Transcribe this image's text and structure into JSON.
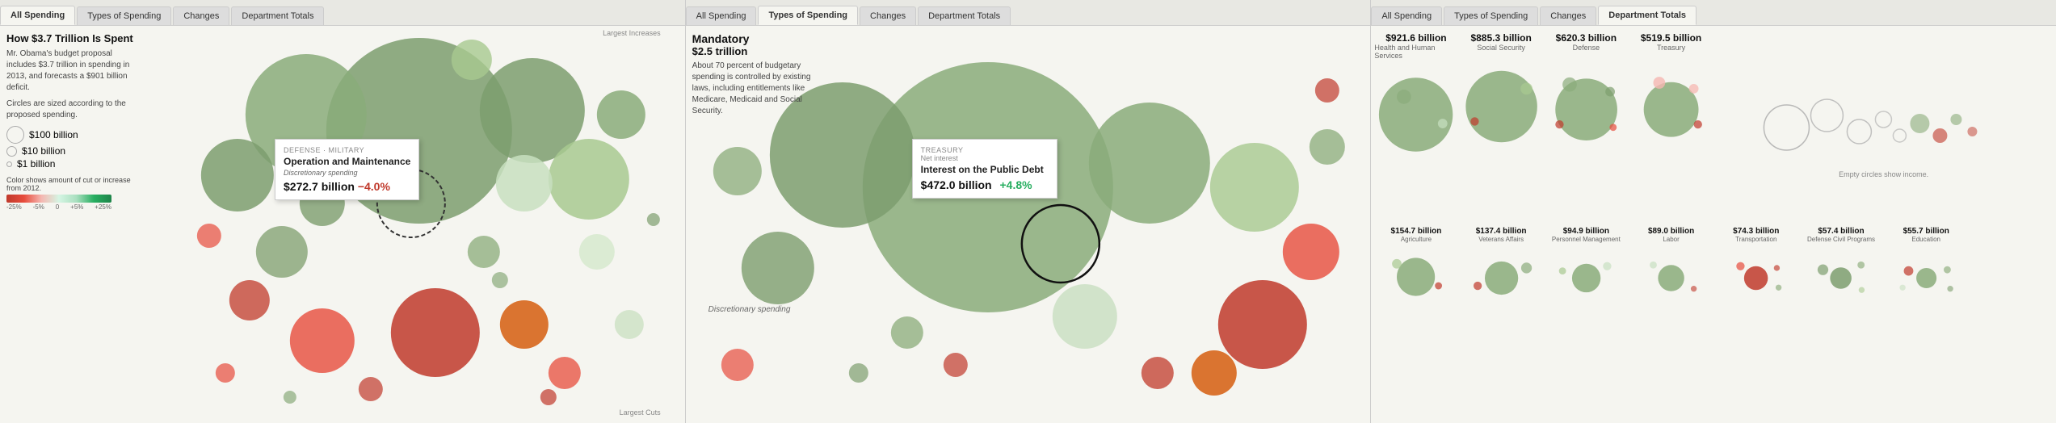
{
  "panels": [
    {
      "id": "panel1",
      "tabs": [
        "All Spending",
        "Types of Spending",
        "Changes",
        "Department Totals"
      ],
      "activeTab": "All Spending",
      "title": "How $3.7 Trillion Is Spent",
      "description": "Mr. Obama's budget proposal includes $3.7 trillion in spending in 2013, and forecasts a $901 billion deficit.",
      "circleNote": "Circles are sized according to the proposed spending.",
      "legendItems": [
        {
          "size": 28,
          "label": "$100 billion"
        },
        {
          "size": 16,
          "label": "$10 billion"
        },
        {
          "size": 8,
          "label": "$1 billion"
        }
      ],
      "colorLegendTitle": "Color shows amount of cut or increase from 2012.",
      "colorLabels": [
        "-25%",
        "-5%",
        "0",
        "+5%",
        "+25%"
      ],
      "tooltip": {
        "label": "DEFENSE · MILITARY",
        "title": "Operation and Maintenance",
        "subtitle": "Discretionary spending",
        "value": "$272.7 billion",
        "change": "−4.0%",
        "changeType": "negative"
      },
      "largestIncreasesLabel": "Largest Increases",
      "largestCutsLabel": "Largest Cuts"
    },
    {
      "id": "panel2",
      "tabs": [
        "All Spending",
        "Types of Spending",
        "Changes",
        "Department Totals"
      ],
      "activeTab": "Types of Spending",
      "mandatoryTitle": "Mandatory",
      "mandatoryAmount": "$2.5 trillion",
      "mandatoryDesc": "About 70 percent of budgetary spending is controlled by existing laws, including entitlements like Medicare, Medicaid and Social Security.",
      "tooltip": {
        "label": "TREASURY",
        "sublabel": "Net interest",
        "title": "Interest on the Public Debt",
        "value": "$472.0 billion",
        "change": "+4.8%",
        "changeType": "positive"
      },
      "discretionaryLabel": "Discretionary spending"
    },
    {
      "id": "panel3",
      "tabs": [
        "All Spending",
        "Types of Spending",
        "Changes",
        "Department Totals"
      ],
      "activeTab": "Department Totals",
      "emptyCirclesNote": "Empty circles show income.",
      "departments": [
        {
          "amount": "$921.6 billion",
          "name": "Health and Human Services",
          "size": 110,
          "color": "#7d9e6e"
        },
        {
          "amount": "$885.3 billion",
          "name": "Social Security",
          "size": 105,
          "color": "#8aab7a"
        },
        {
          "amount": "$620.3 billion",
          "name": "Defense",
          "size": 88,
          "color": "#7d9e6e"
        },
        {
          "amount": "$519.5 billion",
          "name": "Treasury",
          "size": 80,
          "color": "#7d9e6e"
        },
        {
          "amount": "$154.7 billion",
          "name": "Agriculture",
          "size": 44,
          "color": "#8aab7a"
        },
        {
          "amount": "$137.4 billion",
          "name": "Veterans Affairs",
          "size": 40,
          "color": "#8aab7a"
        },
        {
          "amount": "$94.9 billion",
          "name": "Personnel Management",
          "size": 34,
          "color": "#8aab7a"
        },
        {
          "amount": "$89.0 billion",
          "name": "Labor",
          "size": 32,
          "color": "#8aab7a"
        },
        {
          "amount": "$74.3 billion",
          "name": "Transportation",
          "size": 30,
          "color": "#c0392b"
        },
        {
          "amount": "$57.4 billion",
          "name": "Defense Civil Programs",
          "size": 26,
          "color": "#7d9e6e"
        },
        {
          "amount": "$55.7 billion",
          "name": "Education",
          "size": 25,
          "color": "#8aab7a"
        }
      ]
    }
  ]
}
